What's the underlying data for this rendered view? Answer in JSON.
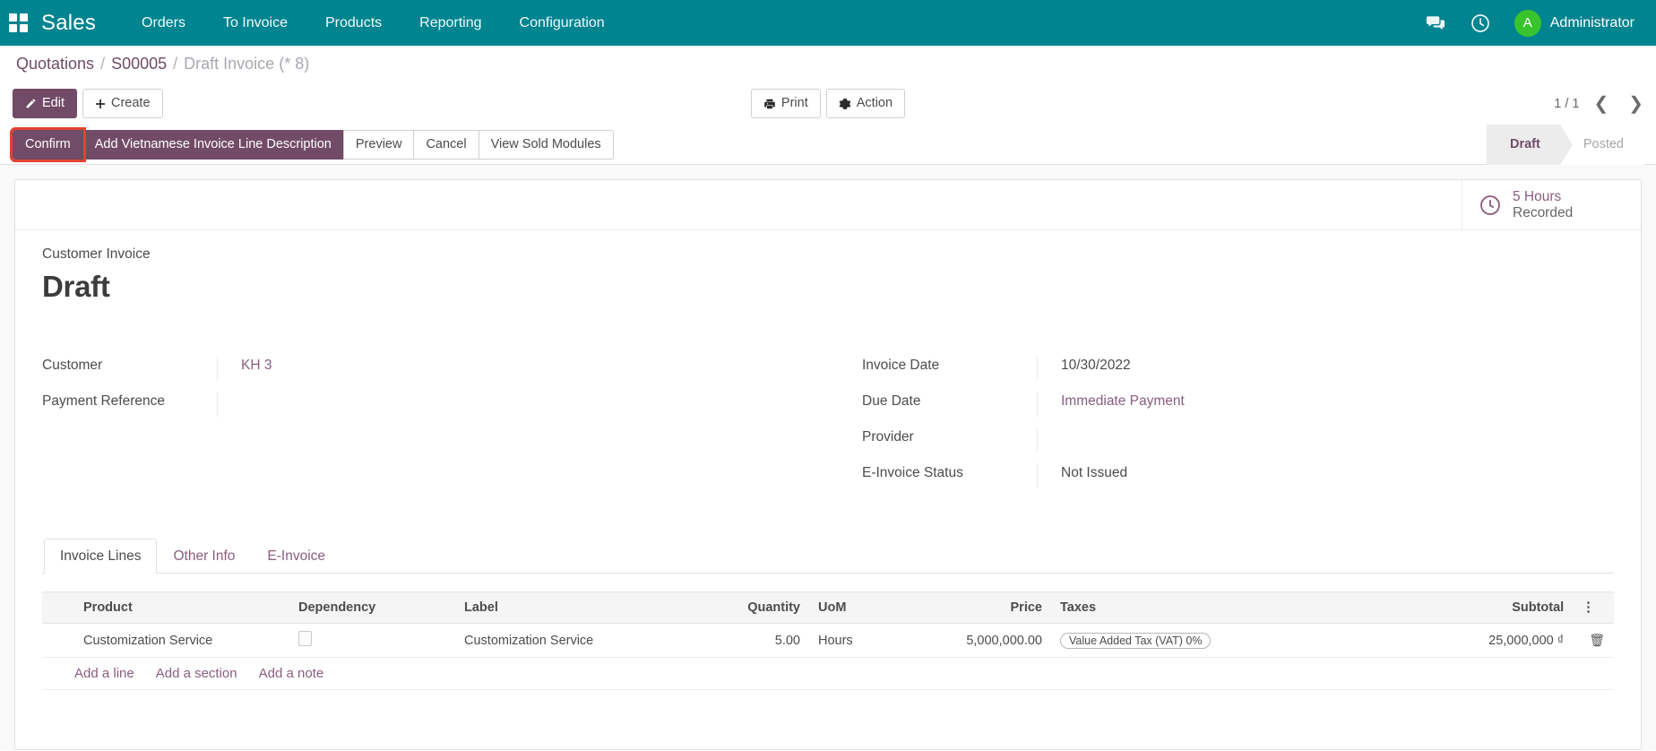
{
  "navbar": {
    "apps_icon": "apps-grid-icon",
    "brand": "Sales",
    "menu": [
      {
        "label": "Orders"
      },
      {
        "label": "To Invoice"
      },
      {
        "label": "Products"
      },
      {
        "label": "Reporting"
      },
      {
        "label": "Configuration"
      }
    ],
    "messages_icon": "messages-icon",
    "activities_icon": "clock-icon",
    "avatar_initial": "A",
    "user_name": "Administrator",
    "bg_color": "#00848f",
    "avatar_color": "#39c42d"
  },
  "breadcrumb": {
    "items": [
      {
        "label": "Quotations",
        "current": false
      },
      {
        "label": "S00005",
        "current": false
      },
      {
        "label": "Draft Invoice (* 8)",
        "current": true
      }
    ],
    "separator": "/"
  },
  "control_panel": {
    "edit_label": "Edit",
    "create_label": "Create",
    "print_label": "Print",
    "action_label": "Action",
    "pager_value": "1 / 1",
    "prev_icon": "chevron-left-icon",
    "next_icon": "chevron-right-icon"
  },
  "statusbar": {
    "buttons": [
      {
        "label": "Confirm",
        "style": "primary",
        "highlighted": true
      },
      {
        "label": "Add Vietnamese Invoice Line Description",
        "style": "primary",
        "highlighted": false
      },
      {
        "label": "Preview",
        "style": "default",
        "highlighted": false
      },
      {
        "label": "Cancel",
        "style": "default",
        "highlighted": false
      },
      {
        "label": "View Sold Modules",
        "style": "default",
        "highlighted": false
      }
    ],
    "states": [
      {
        "label": "Draft",
        "active": true
      },
      {
        "label": "Posted",
        "active": false
      }
    ],
    "highlight_color": "#e34234",
    "primary_color": "#714b67"
  },
  "smart_buttons": [
    {
      "icon": "clock-icon",
      "value": "5 Hours",
      "label": "Recorded"
    }
  ],
  "form": {
    "kicker": "Customer Invoice",
    "title": "Draft",
    "left_fields": [
      {
        "label": "Customer",
        "value": "KH 3",
        "is_link": true
      },
      {
        "label": "Payment Reference",
        "value": "",
        "is_link": false
      }
    ],
    "right_fields": [
      {
        "label": "Invoice Date",
        "value": "10/30/2022",
        "is_link": false
      },
      {
        "label": "Due Date",
        "value": "Immediate Payment",
        "is_link": true
      },
      {
        "label": "Provider",
        "value": "",
        "is_link": false
      },
      {
        "label": "E-Invoice Status",
        "value": "Not Issued",
        "is_link": false
      }
    ]
  },
  "notebook": {
    "tabs": [
      {
        "label": "Invoice Lines",
        "active": true
      },
      {
        "label": "Other Info",
        "active": false
      },
      {
        "label": "E-Invoice",
        "active": false
      }
    ]
  },
  "lines": {
    "columns": [
      {
        "label": "Product",
        "align": "left"
      },
      {
        "label": "Dependency",
        "align": "left"
      },
      {
        "label": "Label",
        "align": "left"
      },
      {
        "label": "Quantity",
        "align": "right"
      },
      {
        "label": "UoM",
        "align": "left"
      },
      {
        "label": "Price",
        "align": "right"
      },
      {
        "label": "Taxes",
        "align": "left"
      },
      {
        "label": "Subtotal",
        "align": "right"
      }
    ],
    "optional_columns_icon": "vertical-dots-icon",
    "rows": [
      {
        "product": "Customization Service",
        "dependency_checked": false,
        "label": "Customization Service",
        "quantity": "5.00",
        "uom": "Hours",
        "price": "5,000,000.00",
        "taxes": "Value Added Tax (VAT) 0%",
        "subtotal": "25,000,000 ₫",
        "delete_icon": "trash-icon"
      }
    ],
    "add_links": [
      {
        "label": "Add a line"
      },
      {
        "label": "Add a section"
      },
      {
        "label": "Add a note"
      }
    ]
  }
}
